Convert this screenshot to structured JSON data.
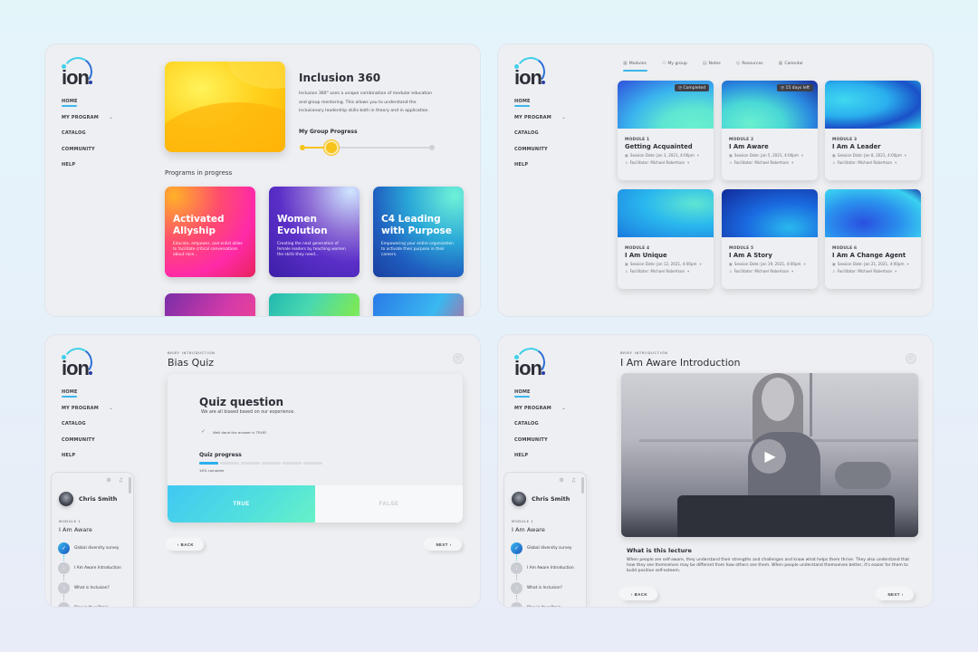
{
  "app": {
    "logo_text": "ion"
  },
  "nav": {
    "items": [
      {
        "label": "HOME",
        "active": true
      },
      {
        "label": "MY PROGRAM",
        "has_chevron": true
      },
      {
        "label": "CATALOG"
      },
      {
        "label": "COMMUNITY"
      },
      {
        "label": "HELP"
      }
    ],
    "chevron_glyph": "⌄"
  },
  "home": {
    "featured": {
      "title": "Inclusion 360",
      "description": "Inclusion 360° uses a unique combination of modular education and group mentoring. This allows you to understand the inclusionary leadership skills both in theory and in application.",
      "progress_label": "My Group Progress",
      "progress_percent": 23
    },
    "programs_title": "Programs in progress",
    "programs": [
      {
        "title": "Activated Allyship",
        "description": "Educate, empower, and enlist allies to facilitate critical conversations about race..."
      },
      {
        "title": "Women Evolution",
        "description": "Creating the next generation of female leaders by teaching women the skills they need..."
      },
      {
        "title": "C4 Leading with Purpose",
        "description": "Empowering your entire organization to activate their purpose in their careers."
      },
      {
        "title": "",
        "description": ""
      },
      {
        "title": "",
        "description": ""
      },
      {
        "title": "",
        "description": ""
      }
    ]
  },
  "program": {
    "tabs": [
      {
        "icon": "grid-icon",
        "glyph": "▦",
        "label": "Modules",
        "active": true
      },
      {
        "icon": "group-icon",
        "glyph": "⚇",
        "label": "My group"
      },
      {
        "icon": "notes-icon",
        "glyph": "▤",
        "label": "Notes"
      },
      {
        "icon": "resources-icon",
        "glyph": "◎",
        "label": "Resources"
      },
      {
        "icon": "calendar-icon",
        "glyph": "▦",
        "label": "Calendar"
      }
    ],
    "modules": [
      {
        "number": "MODULE 1",
        "name": "Getting Acquainted",
        "session": "Session Date: Jan 3, 2021, 4:00pm",
        "facilitator": "Facilitator: Michael Robertson",
        "badge": "Completed"
      },
      {
        "number": "MODULE 2",
        "name": "I Am Aware",
        "session": "Session Date: Jan 5, 2021, 4:00pm",
        "facilitator": "Facilitator: Michael Robertson",
        "badge": "15 days left"
      },
      {
        "number": "MODULE 3",
        "name": "I Am A Leader",
        "session": "Session Date: Jan 8, 2021, 4:00pm",
        "facilitator": "Facilitator: Michael Robertson",
        "badge": ""
      },
      {
        "number": "MODULE 4",
        "name": "I Am Unique",
        "session": "Session Date: Jan 12, 2021, 4:00pm",
        "facilitator": "Facilitator: Michael Robertson",
        "badge": ""
      },
      {
        "number": "MODULE 5",
        "name": "I Am A Story",
        "session": "Session Date: Jan 19, 2021, 4:00pm",
        "facilitator": "Facilitator: Michael Robertson",
        "badge": ""
      },
      {
        "number": "MODULE 6",
        "name": "I Am A Change Agent",
        "session": "Session Date: Jan 21, 2021, 4:00pm",
        "facilitator": "Facilitator: Michael Robertson",
        "badge": ""
      }
    ],
    "calendar_glyph": "▣",
    "person_glyph": "♙",
    "dropdown_glyph": "▾",
    "clock_glyph": "◷"
  },
  "sidebar_card": {
    "icons": "⚙ ♫",
    "user_name": "Chris Smith",
    "module_label": "MODULE 1",
    "module_name": "I Am Aware",
    "steps": [
      {
        "num": "✓",
        "label": "Global diversity survey",
        "done": true
      },
      {
        "num": "2",
        "label": "I Am Aware Introduction",
        "done": false
      },
      {
        "num": "3",
        "label": "What is Inclusion?",
        "done": false
      },
      {
        "num": "4",
        "label": "Bias in Your Brain",
        "done": false
      }
    ]
  },
  "quiz": {
    "breadcrumb": "BRIEF INTRODUCTION",
    "title": "Bias Quiz",
    "question_title": "Quiz question",
    "question": "We are all biased based on our experience.",
    "check_glyph": "✓",
    "feedback": "Well done the answer is TRUE!",
    "progress_label": "Quiz progress",
    "progress_segments_total": 6,
    "progress_segments_done": 1,
    "progress_text": "16% complete",
    "true_label": "TRUE",
    "false_label": "FALSE",
    "back_label": "‹  BACK",
    "next_label": "NEXT  ›",
    "fav_glyph": "♡"
  },
  "lecture": {
    "breadcrumb": "BRIEF INTRODUCTION",
    "title": "I Am Aware Introduction",
    "play_glyph": "▶",
    "section_title": "What is this lecture",
    "body": "When people are self-aware, they understand their strengths and challenges and know what helps them thrive. They also understand that how they see themselves may be different from how others see them. When people understand themselves better, it's easier for them to build positive self-esteem.",
    "back_label": "‹  BACK",
    "next_label": "NEXT  ›",
    "fav_glyph": "♡"
  }
}
